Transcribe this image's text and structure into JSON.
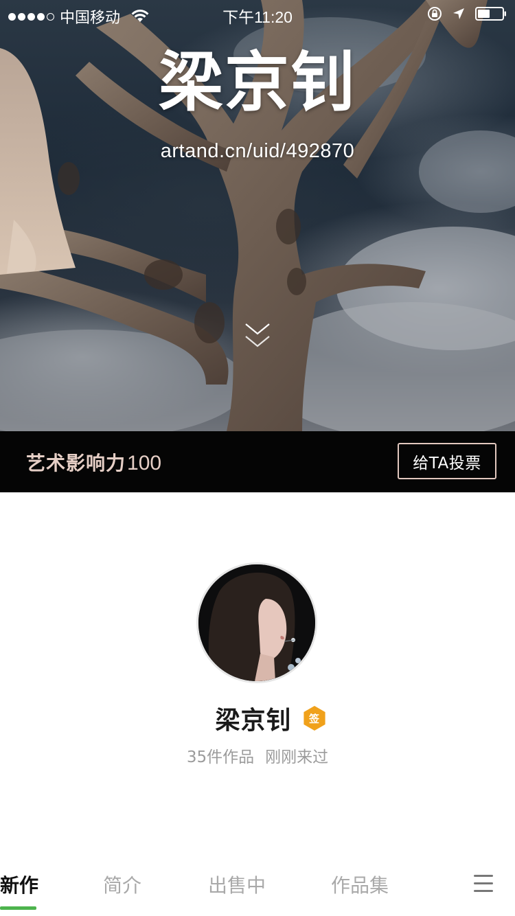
{
  "status_bar": {
    "carrier": "中国移动",
    "time": "下午11:20"
  },
  "hero": {
    "artist_name": "梁京钊",
    "url": "artand.cn/uid/492870"
  },
  "influence": {
    "label": "艺术影响力",
    "value": "100",
    "vote_button": "给TA投票"
  },
  "profile": {
    "name": "梁京钊",
    "badge": "签",
    "works_count": "35件作品",
    "last_seen": "刚刚来过"
  },
  "tabs": [
    {
      "label": "新作",
      "active": true
    },
    {
      "label": "简介",
      "active": false
    },
    {
      "label": "出售中",
      "active": false
    },
    {
      "label": "作品集",
      "active": false
    }
  ],
  "colors": {
    "accent_green": "#4db34d",
    "badge_orange": "#f0a11b",
    "influence_text": "#e6cfc6"
  }
}
